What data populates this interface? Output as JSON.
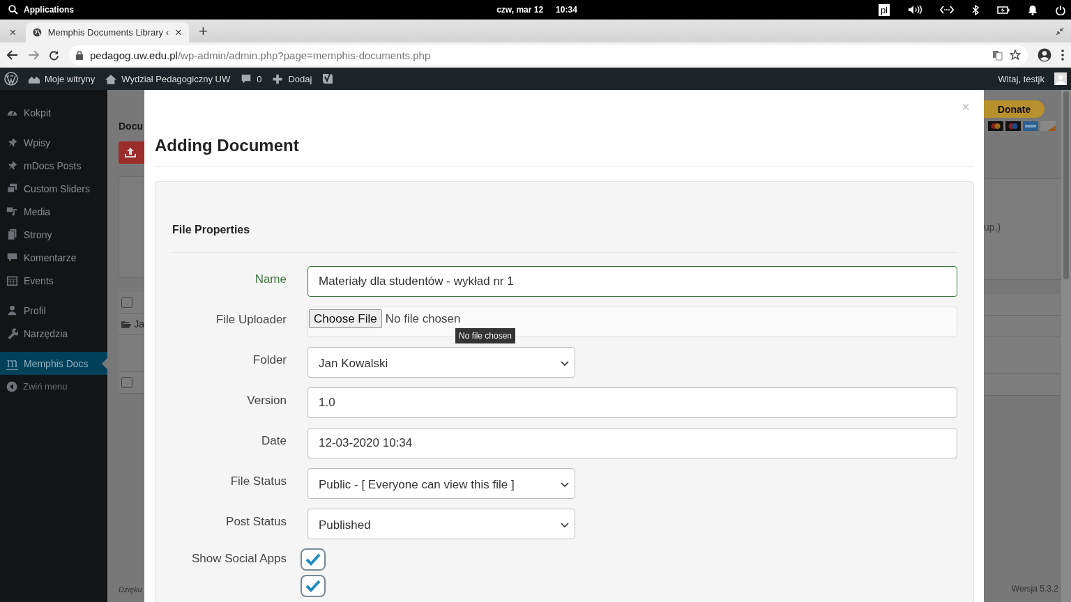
{
  "os_bar": {
    "apps_label": "Applications",
    "date": "czw, mar 12",
    "time": "10:34",
    "keyboard_layout": "pl"
  },
  "browser": {
    "tabs": [
      {
        "close": "×",
        "selected": false
      },
      {
        "title": "Memphis Documents Library ‹",
        "close": "×",
        "selected": true
      }
    ],
    "new_tab": "+",
    "url_host": "pedagog.uw.edu.pl",
    "url_path": "/wp-admin/admin.php?page=memphis-documents.php"
  },
  "admin_bar": {
    "items": [
      {
        "kind": "sites",
        "label": "Moje witryny"
      },
      {
        "kind": "home",
        "label": "Wydział Pedagogiczny UW"
      },
      {
        "kind": "comments",
        "label": "0"
      },
      {
        "kind": "new",
        "label": "Dodaj"
      }
    ],
    "greeting": "Witaj, testjk"
  },
  "sidebar": {
    "groups": [
      [
        {
          "label": "Kokpit",
          "selected": false
        }
      ],
      [
        {
          "label": "Wpisy",
          "selected": false
        },
        {
          "label": "mDocs Posts",
          "selected": false
        },
        {
          "label": "Custom Sliders",
          "selected": false
        },
        {
          "label": "Media",
          "selected": false
        },
        {
          "label": "Strony",
          "selected": false
        },
        {
          "label": "Komentarze",
          "selected": false
        },
        {
          "label": "Events",
          "selected": false
        }
      ],
      [
        {
          "label": "Profil",
          "selected": false
        },
        {
          "label": "Narzędzia",
          "selected": false
        }
      ],
      [
        {
          "icon_char": "m",
          "label": "Memphis Docs",
          "selected": true
        }
      ]
    ],
    "collapse": "Zwiń menu"
  },
  "background": {
    "checkboxes": [
      {
        "checked": false
      },
      {
        "checked": false
      }
    ],
    "heading": "Docu",
    "folder_row": "Ja",
    "note": "up.)",
    "footer_left": "Dzięku",
    "version": "Wersja 5.3.2",
    "donate": "Donate"
  },
  "modal": {
    "title": "Adding Document",
    "close": "×",
    "section": "File Properties",
    "fields": [
      {
        "kind": "text",
        "label": "Name",
        "value": "Materiały dla studentów - wykład nr 1",
        "valid": true
      },
      {
        "kind": "file",
        "label": "File Uploader",
        "button": "Choose File",
        "status": "No file chosen",
        "tooltip": "No file chosen",
        "valid": false
      },
      {
        "kind": "select",
        "label": "Folder",
        "value": "Jan Kowalski",
        "valid": false
      },
      {
        "kind": "text",
        "label": "Version",
        "value": "1.0",
        "valid": false
      },
      {
        "kind": "text",
        "label": "Date",
        "value": "12-03-2020 10:34",
        "valid": false
      },
      {
        "kind": "select",
        "label": "File Status",
        "value": "Public - [ Everyone can view this file ]",
        "valid": false
      },
      {
        "kind": "select",
        "label": "Post Status",
        "value": "Published",
        "valid": false
      }
    ],
    "checkboxes": [
      {
        "label": "Show Social Apps",
        "checked": true
      },
      {
        "checked": true
      }
    ]
  }
}
